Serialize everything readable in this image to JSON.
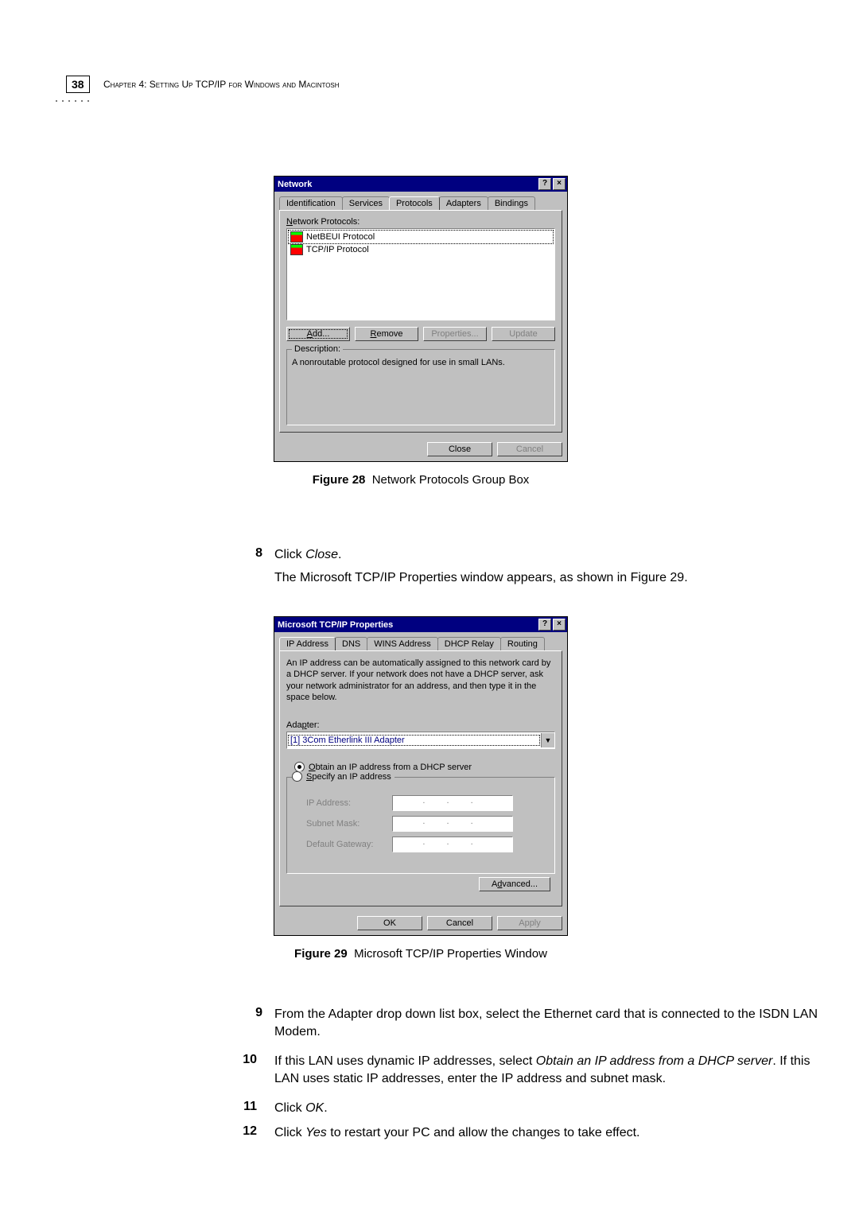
{
  "page": {
    "number": "38",
    "chapter_heading": "Chapter 4: Setting Up TCP/IP for Windows and Macintosh",
    "dotted": "······"
  },
  "figure28": {
    "caption_label": "Figure 28",
    "caption_text": "Network Protocols Group Box",
    "dialog": {
      "title": "Network",
      "tabs": {
        "identification": "Identification",
        "services": "Services",
        "protocols": "Protocols",
        "adapters": "Adapters",
        "bindings": "Bindings"
      },
      "protocols_label": "Network Protocols:",
      "protocols": [
        {
          "name": "NetBEUI Protocol",
          "selected": true
        },
        {
          "name": "TCP/IP Protocol",
          "selected": false
        }
      ],
      "buttons": {
        "add": "Add...",
        "remove": "Remove",
        "properties": "Properties...",
        "update": "Update"
      },
      "description_label": "Description:",
      "description_text": "A nonroutable protocol designed for use in small LANs.",
      "close": "Close",
      "cancel": "Cancel",
      "help": "?",
      "x": "×"
    }
  },
  "step8": {
    "num": "8",
    "text_a": "Click ",
    "em": "Close",
    "text_b": ".",
    "followup": "The Microsoft TCP/IP Properties window appears, as shown in Figure 29."
  },
  "figure29": {
    "caption_label": "Figure 29",
    "caption_text": "Microsoft TCP/IP Properties Window",
    "dialog": {
      "title": "Microsoft TCP/IP Properties",
      "tabs": {
        "ip": "IP Address",
        "dns": "DNS",
        "wins": "WINS Address",
        "dhcp": "DHCP Relay",
        "routing": "Routing"
      },
      "intro": "An IP address can be automatically assigned to this network card by a DHCP server. If your network does not have a DHCP server, ask your network administrator for an address, and then type it in the space below.",
      "adapter_label": "Adapter:",
      "adapter_value": "[1] 3Com Etherlink III Adapter",
      "radio_dhcp": "Obtain an IP address from a DHCP server",
      "radio_specify": "Specify an IP address",
      "ip_label": "IP Address:",
      "subnet_label": "Subnet Mask:",
      "gateway_label": "Default Gateway:",
      "ip_dots": ". . .",
      "advanced": "Advanced...",
      "ok": "OK",
      "cancel": "Cancel",
      "apply": "Apply",
      "help": "?",
      "x": "×"
    }
  },
  "step9": {
    "num": "9",
    "text": "From the Adapter drop down list box, select the Ethernet card that is connected to the ISDN LAN Modem."
  },
  "step10": {
    "num": "10",
    "text_a": "If this LAN uses dynamic IP addresses, select ",
    "em": "Obtain an IP address from a DHCP server",
    "text_b": ". If this LAN uses static IP addresses, enter the IP address and subnet mask."
  },
  "step11": {
    "num": "11",
    "text_a": "Click ",
    "em": "OK",
    "text_b": "."
  },
  "step12": {
    "num": "12",
    "text_a": "Click ",
    "em": "Yes",
    "text_b": " to restart your PC and allow the changes to take effect."
  }
}
